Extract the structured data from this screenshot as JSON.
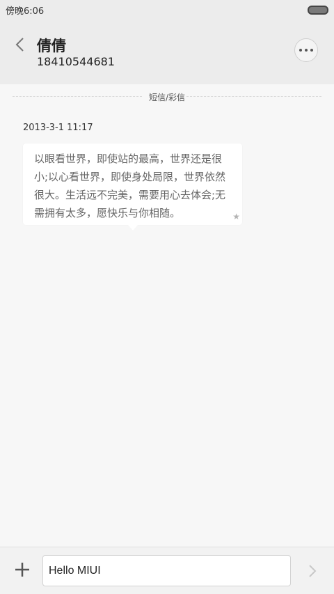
{
  "status_bar": {
    "time": "傍晚6:06",
    "battery_icon": "battery-icon"
  },
  "header": {
    "back_icon": "chevron-left-icon",
    "contact_name": "倩倩",
    "contact_number": "18410544681",
    "more_icon": "more-horizontal-icon"
  },
  "thread": {
    "divider_label": "短信/彩信",
    "messages": [
      {
        "timestamp": "2013-3-1 11:17",
        "text": "以眼看世界，即使站的最高，世界还是很小;以心看世界，即使身处局限，世界依然很大。生活远不完美，需要用心去体会;无需拥有太多，愿快乐与你相随。",
        "star_icon": "star-icon",
        "star": "★"
      }
    ]
  },
  "composer": {
    "add_icon": "plus-icon",
    "input_value": "Hello MIUI",
    "send_icon": "chevron-right-icon"
  },
  "colors": {
    "background": "#f7f7f7",
    "header_background": "#ececec",
    "bubble_background": "#ffffff",
    "text_primary": "#222222",
    "bubble_text": "#666666"
  }
}
